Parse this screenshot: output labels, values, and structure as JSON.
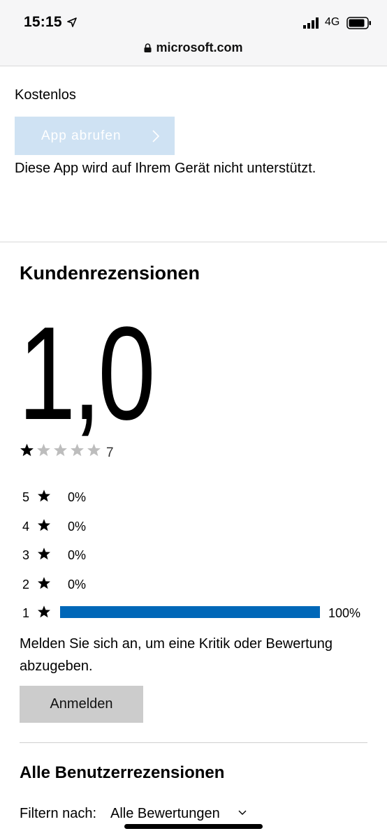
{
  "status_bar": {
    "time": "15:15",
    "network": "4G",
    "icons": [
      "location-arrow-icon",
      "signal-icon",
      "battery-icon"
    ]
  },
  "browser": {
    "url": "microsoft.com",
    "lock_icon": "lock-icon"
  },
  "app": {
    "price": "Kostenlos",
    "get_app_label": "App abrufen",
    "unsupported_text": "Diese App wird auf Ihrem Gerät nicht unterstützt.",
    "accent_button_color": "#cfe2f3"
  },
  "reviews": {
    "title": "Kundenrezensionen",
    "rating": "1,0",
    "stars_filled": 1,
    "stars_total": 5,
    "rating_count": "7",
    "histogram": [
      {
        "stars": "5",
        "percent": "0%",
        "fraction": 0
      },
      {
        "stars": "4",
        "percent": "0%",
        "fraction": 0
      },
      {
        "stars": "3",
        "percent": "0%",
        "fraction": 0
      },
      {
        "stars": "2",
        "percent": "0%",
        "fraction": 0
      },
      {
        "stars": "1",
        "percent": "100%",
        "fraction": 1
      }
    ],
    "bar_color": "#0067b8",
    "signin_prompt": "Melden Sie sich an, um eine Kritik oder Bewertung abzugeben.",
    "signin_button": "Anmelden"
  },
  "all_reviews": {
    "title": "Alle Benutzerrezensionen",
    "filter_label": "Filtern nach:",
    "filter_value": "Alle Bewertungen"
  }
}
